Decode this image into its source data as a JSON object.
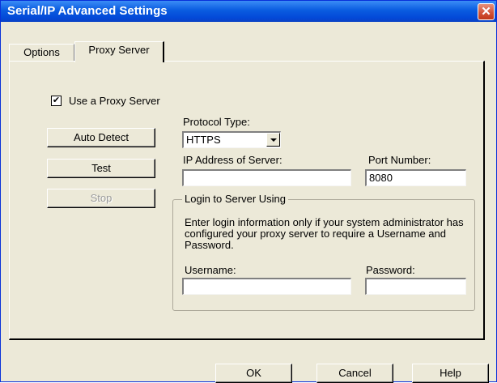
{
  "window": {
    "title": "Serial/IP Advanced Settings",
    "close_glyph": "✕"
  },
  "tabs": [
    {
      "label": "Options",
      "active": false
    },
    {
      "label": "Proxy Server",
      "active": true
    }
  ],
  "proxy": {
    "use_proxy_label": "Use a Proxy Server",
    "use_proxy_checked": true,
    "check_glyph": "✔",
    "buttons": {
      "auto_detect": "Auto Detect",
      "test": "Test",
      "stop": "Stop"
    },
    "protocol_label": "Protocol Type:",
    "protocol_value": "HTTPS",
    "ip_label": "IP Address of Server:",
    "ip_value": "",
    "port_label": "Port Number:",
    "port_value": "8080",
    "login_group_title": "Login to Server Using",
    "login_note": "Enter login information only if your system administrator has configured your proxy server to require a Username and Password.",
    "username_label": "Username:",
    "username_value": "",
    "password_label": "Password:",
    "password_value": ""
  },
  "footer": {
    "ok": "OK",
    "cancel": "Cancel",
    "help": "Help"
  },
  "colors": {
    "titlebar": "#0a5ce0",
    "dialog_bg": "#ece9d8",
    "close_button": "#d2543a"
  },
  "icons": {
    "close": "close-icon",
    "dropdown": "chevron-down-icon",
    "checkbox": "checkmark-icon"
  }
}
